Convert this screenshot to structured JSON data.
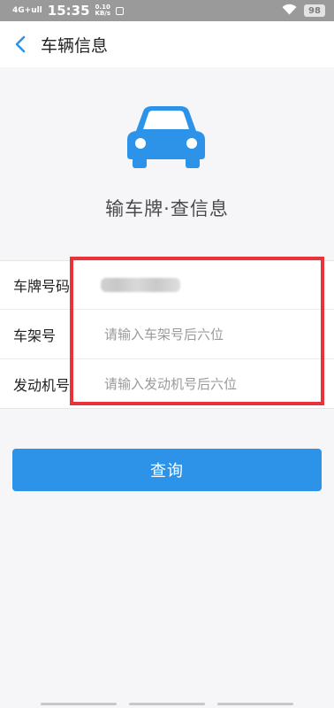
{
  "status_bar": {
    "signal": "4G+ull",
    "time": "15:35",
    "net_speed_value": "0.10",
    "net_speed_unit": "KB/s",
    "battery": "98",
    "icons": [
      "signal-icon",
      "notification-icon",
      "wifi-icon",
      "battery-icon"
    ]
  },
  "header": {
    "title": "车辆信息",
    "back_icon": "chevron-left-icon"
  },
  "hero": {
    "icon": "car-icon",
    "icon_color": "#2c93e8",
    "tagline": "输车牌·查信息"
  },
  "form": {
    "plate_label": "车牌号码",
    "frame_label": "车架号",
    "frame_placeholder": "请输入车架号后六位",
    "engine_label": "发动机号",
    "engine_placeholder": "请输入发动机号后六位"
  },
  "actions": {
    "query_label": "查询"
  },
  "colors": {
    "accent": "#2c93e8",
    "highlight": "#e8333a"
  }
}
